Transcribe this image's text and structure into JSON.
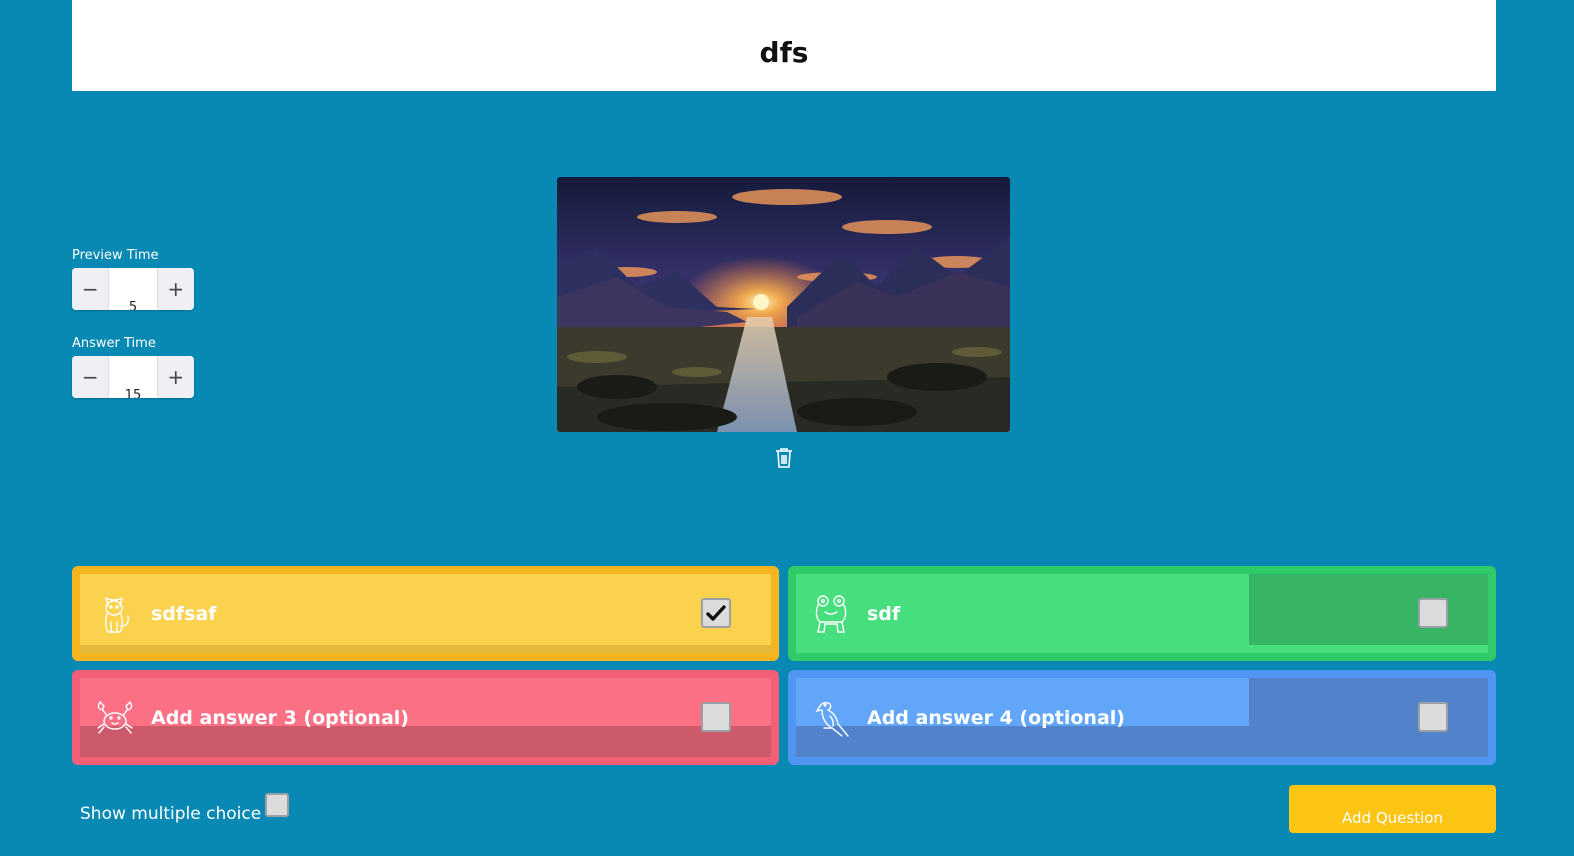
{
  "question": {
    "title": "dfs"
  },
  "timers": {
    "preview_label": "Preview Time",
    "preview_value": "5",
    "answer_label": "Answer Time",
    "answer_value": "15",
    "minus": "−",
    "plus": "+"
  },
  "media": {
    "icon": "trash-icon"
  },
  "answers": [
    {
      "text": "sdfsaf",
      "icon": "cat-icon",
      "checked": true,
      "color": "#fbd24e"
    },
    {
      "text": "sdf",
      "icon": "frog-icon",
      "checked": false,
      "color": "#47de7e"
    },
    {
      "text": "Add answer 3 (optional)",
      "icon": "crab-icon",
      "checked": false,
      "color": "#fc7086"
    },
    {
      "text": "Add answer 4 (optional)",
      "icon": "parrot-icon",
      "checked": false,
      "color": "#62a6fa"
    }
  ],
  "footer": {
    "multiple_choice_label": "Show multiple choice",
    "add_question_label": "Add Question"
  },
  "colors": {
    "background": "#0789b3",
    "accent": "#fcc413"
  }
}
